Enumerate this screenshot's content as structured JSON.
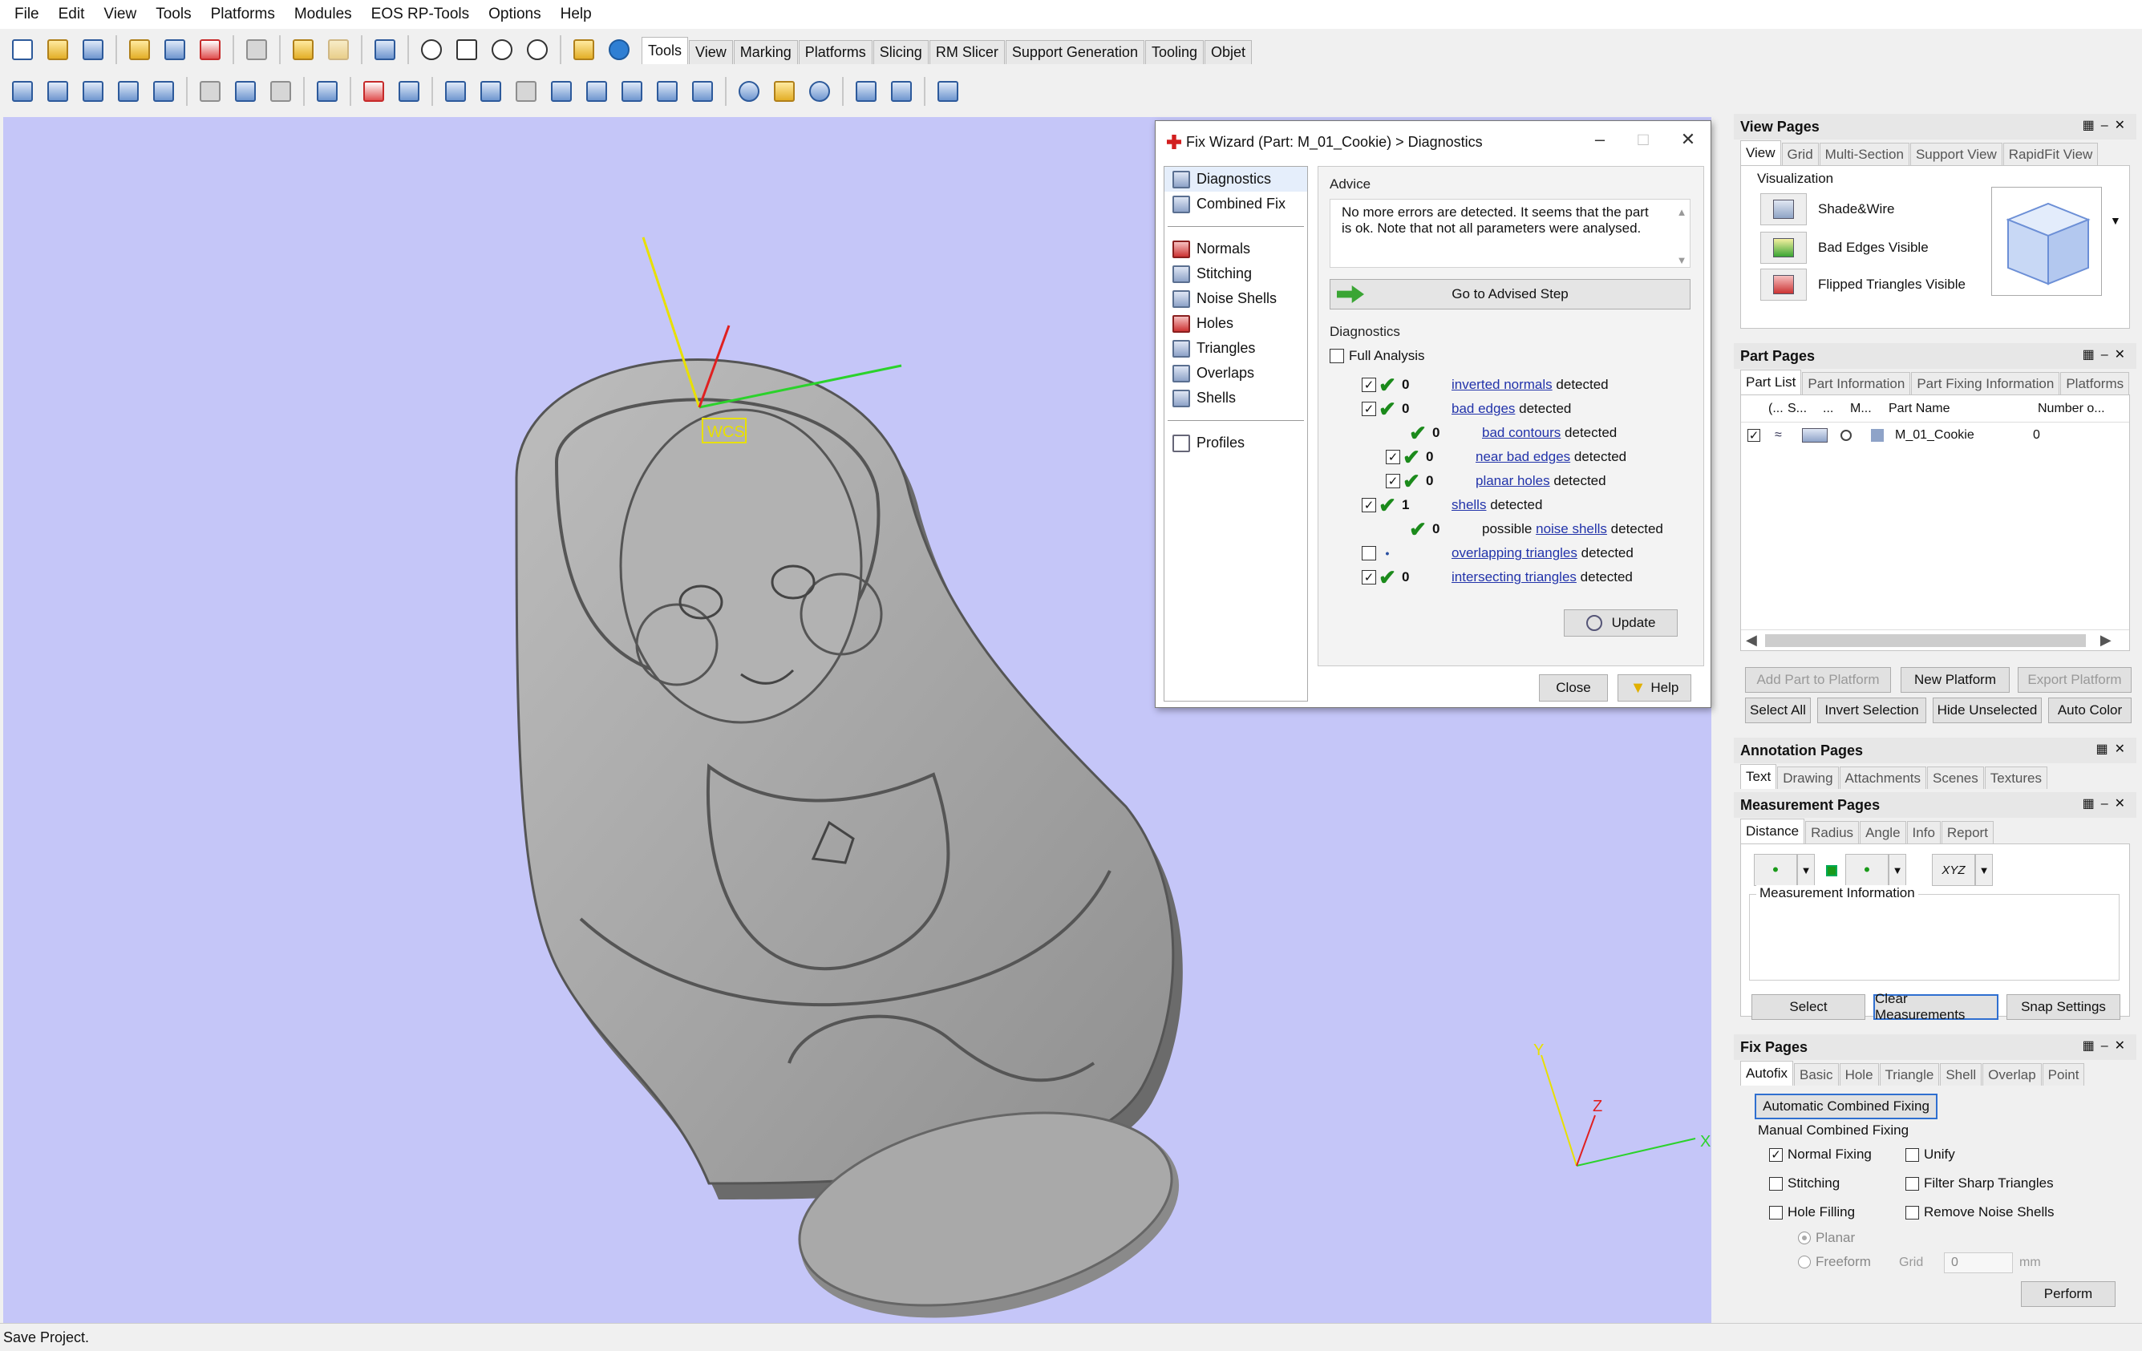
{
  "menu": [
    "File",
    "Edit",
    "View",
    "Tools",
    "Platforms",
    "Modules",
    "EOS RP-Tools",
    "Options",
    "Help"
  ],
  "toolbar_tabs": [
    "Tools",
    "View",
    "Marking",
    "Platforms",
    "Slicing",
    "RM Slicer",
    "Support Generation",
    "Tooling",
    "Objet"
  ],
  "toolbar_active_tab": "Tools",
  "viewport": {
    "wcs_label": "WCS",
    "axis_x": "X",
    "axis_y": "Y",
    "axis_z": "Z",
    "background": "#c5c6f8"
  },
  "status_text": "Save Project.",
  "fix_wizard": {
    "title": "Fix Wizard (Part: M_01_Cookie) > Diagnostics",
    "nav": [
      {
        "label": "Diagnostics",
        "icon": "magnifier-icon"
      },
      {
        "label": "Combined Fix",
        "icon": "combined-fix-icon"
      },
      {
        "label": "Normals",
        "icon": "normals-icon"
      },
      {
        "label": "Stitching",
        "icon": "stitching-icon"
      },
      {
        "label": "Noise Shells",
        "icon": "noise-shells-icon"
      },
      {
        "label": "Holes",
        "icon": "holes-icon"
      },
      {
        "label": "Triangles",
        "icon": "triangles-icon"
      },
      {
        "label": "Overlaps",
        "icon": "overlaps-icon"
      },
      {
        "label": "Shells",
        "icon": "shells-icon"
      },
      {
        "label": "Profiles",
        "icon": "profiles-icon"
      }
    ],
    "advice_title": "Advice",
    "advice_text": "No more errors are detected. It seems that the part is ok. Note that not all parameters were analysed.",
    "go_button": "Go to Advised Step",
    "diagnostics_title": "Diagnostics",
    "full_analysis": "Full Analysis",
    "detected_word": "detected",
    "possible_word": "possible",
    "rows": {
      "inverted_normals": {
        "value": "0",
        "label": "inverted normals"
      },
      "bad_edges": {
        "value": "0",
        "label": "bad edges"
      },
      "bad_contours": {
        "value": "0",
        "label": "bad contours"
      },
      "near_bad_edges": {
        "value": "0",
        "label": "near bad edges"
      },
      "planar_holes": {
        "value": "0",
        "label": "planar holes"
      },
      "shells": {
        "value": "1",
        "label": "shells"
      },
      "noise_shells": {
        "value": "0",
        "label": "noise shells"
      },
      "overlapping_triangles": {
        "label": "overlapping triangles"
      },
      "intersecting_triangles": {
        "value": "0",
        "label": "intersecting triangles"
      }
    },
    "update_button": "Update",
    "close_button": "Close",
    "help_button": "Help"
  },
  "view_pages": {
    "title": "View Pages",
    "tabs": [
      "View",
      "Grid",
      "Multi-Section",
      "Support View",
      "RapidFit View"
    ],
    "group": "Visualization",
    "items": [
      "Shade&Wire",
      "Bad Edges Visible",
      "Flipped Triangles Visible"
    ]
  },
  "part_pages": {
    "title": "Part Pages",
    "tabs": [
      "Part List",
      "Part Information",
      "Part Fixing Information",
      "Platforms"
    ],
    "columns": [
      "(...",
      "S...",
      "...",
      "M...",
      "Part Name",
      "Number o..."
    ],
    "row": {
      "name": "M_01_Cookie",
      "number": "0"
    },
    "buttons": [
      "Add Part to Platform",
      "New Platform",
      "Export Platform",
      "Select All",
      "Invert Selection",
      "Hide Unselected",
      "Auto Color"
    ]
  },
  "annotation_pages": {
    "title": "Annotation Pages",
    "tabs": [
      "Text",
      "Drawing",
      "Attachments",
      "Scenes",
      "Textures"
    ]
  },
  "measurement_pages": {
    "title": "Measurement Pages",
    "tabs": [
      "Distance",
      "Radius",
      "Angle",
      "Info",
      "Report"
    ],
    "xyz": "XYZ",
    "info_label": "Measurement Information",
    "buttons": [
      "Select",
      "Clear Measurements",
      "Snap Settings"
    ]
  },
  "fix_pages": {
    "title": "Fix Pages",
    "tabs": [
      "Autofix",
      "Basic",
      "Hole",
      "Triangle",
      "Shell",
      "Overlap",
      "Point"
    ],
    "auto_button": "Automatic Combined Fixing",
    "manual_title": "Manual Combined Fixing",
    "options": {
      "normal": "Normal Fixing",
      "unify": "Unify",
      "stitching": "Stitching",
      "filter": "Filter Sharp Triangles",
      "hole": "Hole Filling",
      "noise": "Remove Noise Shells"
    },
    "planar": "Planar",
    "freeform": "Freeform",
    "grid_label": "Grid",
    "grid_value": "0",
    "unit": "mm",
    "perform": "Perform"
  }
}
